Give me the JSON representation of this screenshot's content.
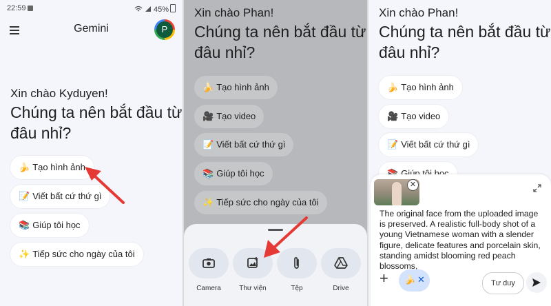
{
  "panel1": {
    "status": {
      "time": "22:59",
      "battery": "45%"
    },
    "app_title": "Gemini",
    "avatar_letter": "P",
    "greeting": "Xin chào Kyduyen!",
    "prompt_line1": "Chúng ta nên bắt đầu từ",
    "prompt_line2": "đâu nhỉ?",
    "chips": [
      {
        "emoji": "🍌",
        "label": "Tạo hình ảnh"
      },
      {
        "emoji": "📝",
        "label": "Viết bất cứ thứ gì"
      },
      {
        "emoji": "📚",
        "label": "Giúp tôi học"
      },
      {
        "emoji": "✨",
        "label": "Tiếp sức cho ngày của tôi"
      }
    ]
  },
  "panel2": {
    "greeting": "Xin chào Phan!",
    "prompt_line1": "Chúng ta nên bắt đầu từ",
    "prompt_line2": "đâu nhỉ?",
    "chips": [
      {
        "emoji": "🍌",
        "label": "Tạo hình ảnh"
      },
      {
        "emoji": "🎥",
        "label": "Tạo video"
      },
      {
        "emoji": "📝",
        "label": "Viết bất cứ thứ gì"
      },
      {
        "emoji": "📚",
        "label": "Giúp tôi học"
      },
      {
        "emoji": "✨",
        "label": "Tiếp sức cho ngày của tôi"
      }
    ],
    "sheet": {
      "camera": "Camera",
      "gallery": "Thư viện",
      "file": "Tệp",
      "drive": "Drive"
    }
  },
  "panel3": {
    "greeting": "Xin chào Phan!",
    "prompt_line1": "Chúng ta nên bắt đầu từ",
    "prompt_line2": "đâu nhỉ?",
    "chips": [
      {
        "emoji": "🍌",
        "label": "Tạo hình ảnh"
      },
      {
        "emoji": "🎥",
        "label": "Tạo video"
      },
      {
        "emoji": "📝",
        "label": "Viết bất cứ thứ gì"
      },
      {
        "emoji": "📚",
        "label": "Giúp tôi học"
      }
    ],
    "input_text": "The original face from the uploaded image is preserved. A realistic full-body shot of a young Vietnamese woman with a slender figure, delicate features and porcelain skin, standing amidst blooming red peach blossoms,",
    "selected_tool_emoji": "🍌",
    "thinking_label": "Tư duy"
  },
  "colors": {
    "arrow": "#e53935",
    "accent": "#0b57d0"
  }
}
